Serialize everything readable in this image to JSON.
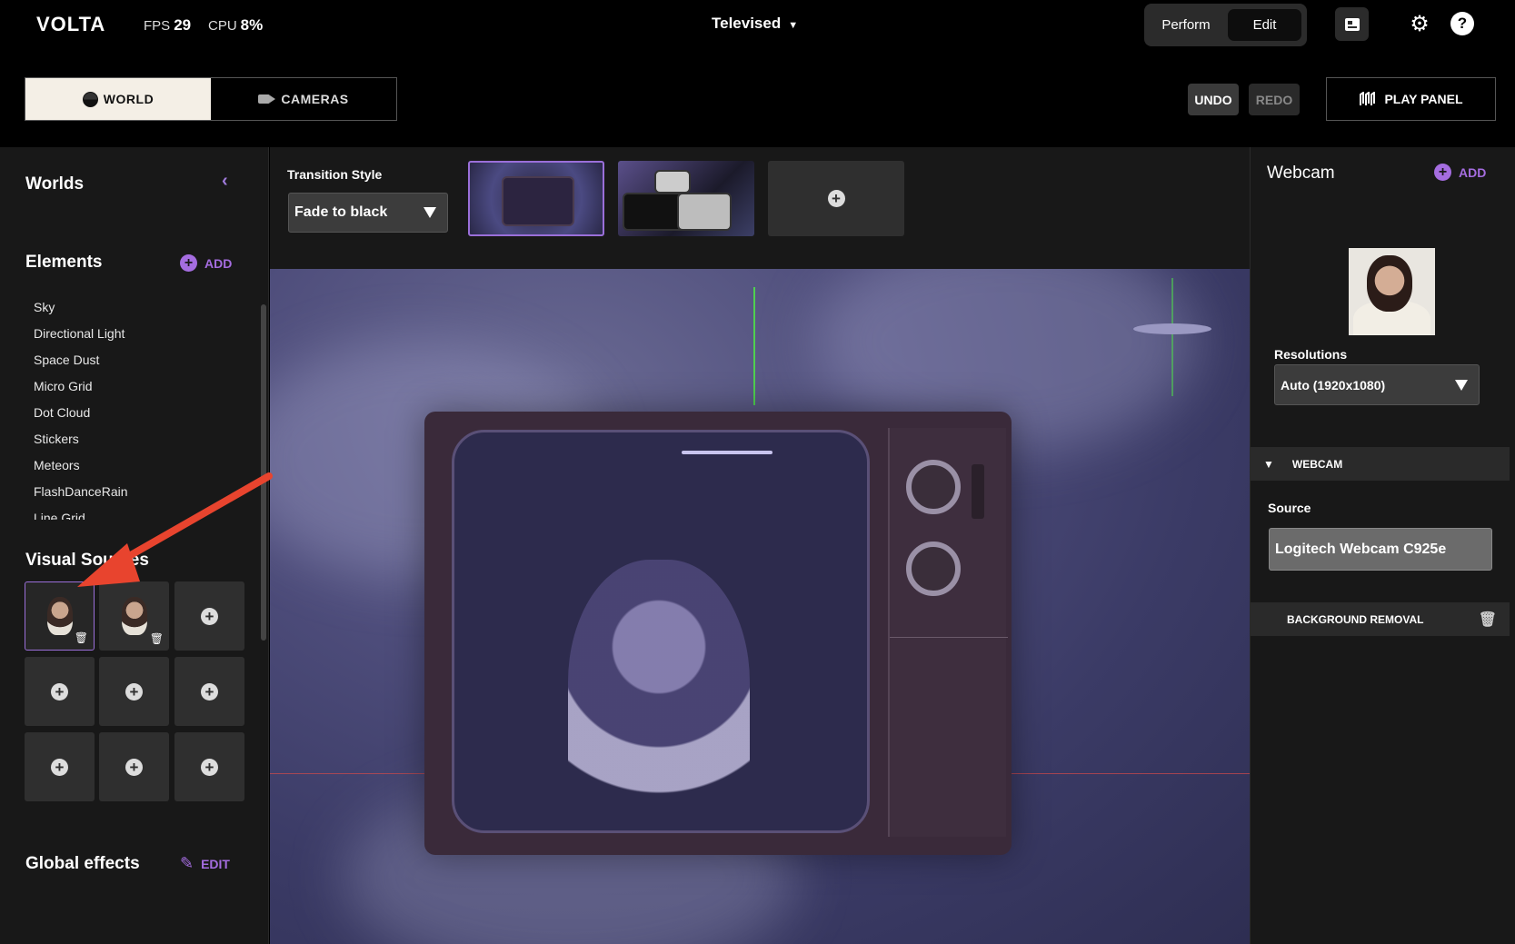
{
  "header": {
    "logo": "VOLTA",
    "fps_label": "FPS",
    "fps_value": "29",
    "cpu_label": "CPU",
    "cpu_value": "8%",
    "world_name": "Televised",
    "mode_perform": "Perform",
    "mode_edit": "Edit",
    "icons": [
      "media-icon",
      "gear-icon",
      "help-icon"
    ]
  },
  "toolbar": {
    "tab_world": "WORLD",
    "tab_cameras": "CAMERAS",
    "undo": "UNDO",
    "redo": "REDO",
    "play_panel": "PLAY PANEL"
  },
  "left": {
    "worlds_title": "Worlds",
    "elements_title": "Elements",
    "add_label": "ADD",
    "elements": [
      "Sky",
      "Directional Light",
      "Space Dust",
      "Micro Grid",
      "Dot Cloud",
      "Stickers",
      "Meteors",
      "FlashDanceRain",
      "Line Grid"
    ],
    "visual_sources_title": "Visual Sources",
    "global_effects_title": "Global effects",
    "edit_label": "EDIT"
  },
  "transition": {
    "label": "Transition Style",
    "selected": "Fade to black"
  },
  "right": {
    "title": "Webcam",
    "add_label": "ADD",
    "resolutions_label": "Resolutions",
    "resolution_selected": "Auto (1920x1080)",
    "webcam_section": "WEBCAM",
    "source_label": "Source",
    "source_value": "Logitech Webcam C925e",
    "background_removal": "BACKGROUND REMOVAL"
  },
  "colors": {
    "accent": "#a56de0",
    "background": "#000000",
    "panel": "#181818",
    "annotation_arrow": "#e8442e"
  }
}
